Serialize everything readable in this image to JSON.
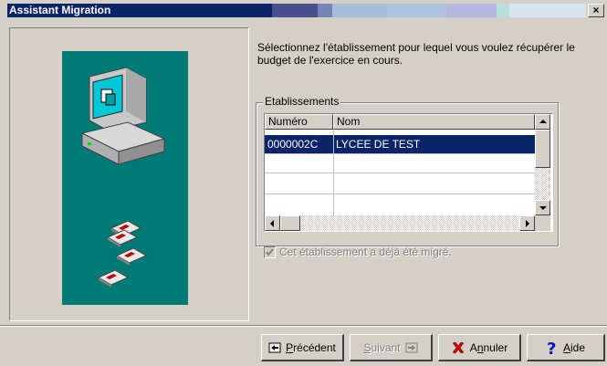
{
  "window": {
    "title": "Assistant Migration",
    "close_glyph": "×"
  },
  "instruction": "Sélectionnez l'établissement pour lequel vous voulez récupérer le budget de l'exercice en cours.",
  "group": {
    "label": "Etablissements",
    "columns": [
      "Numéro",
      "Nom"
    ],
    "rows": [
      {
        "numero": "0000002C",
        "nom": "LYCEE DE TEST",
        "selected": true
      }
    ]
  },
  "checkbox": {
    "label": "Cet établissement a déjà été migré.",
    "checked": true,
    "disabled": true
  },
  "buttons": {
    "previous": {
      "mnemonic": "P",
      "rest": "récédent",
      "icon": "back-arrow-icon"
    },
    "next": {
      "mnemonic": "S",
      "rest": "uivant",
      "icon": "forward-arrow-icon",
      "disabled": true
    },
    "cancel": {
      "prefix": "A",
      "mnemonic": "n",
      "rest": "nuler",
      "icon": "red-x-icon"
    },
    "help": {
      "mnemonic": "A",
      "rest": "ide",
      "icon": "question-mark-icon"
    }
  },
  "colors": {
    "titlebar": "#0a246a",
    "panel_teal": "#007a75",
    "selection": "#0a246a",
    "face": "#d4d0c8"
  }
}
